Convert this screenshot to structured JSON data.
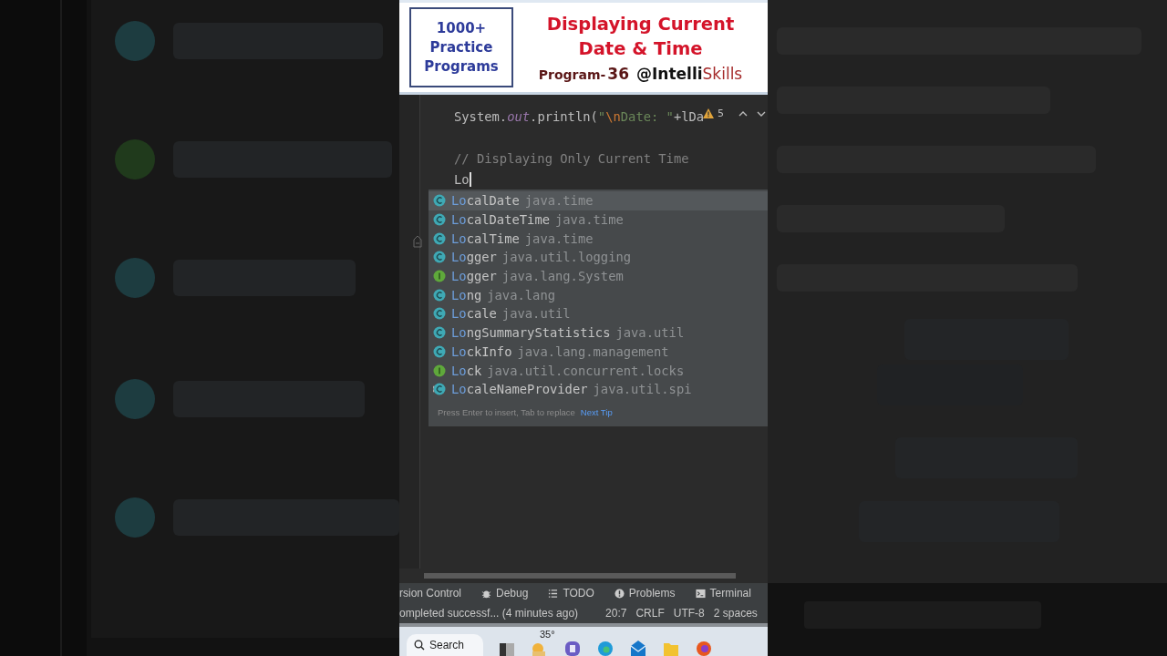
{
  "banner": {
    "badge_lines": [
      "1000+",
      "Practice",
      "Programs"
    ],
    "title_lines": [
      "Displaying Current",
      "Date & Time"
    ],
    "program_label": "Program-",
    "program_number": "36",
    "channel_main": "@Intelli",
    "channel_accent": "Skills"
  },
  "editor": {
    "code_line": [
      {
        "kind": "plain",
        "text": "System."
      },
      {
        "kind": "field",
        "text": "out"
      },
      {
        "kind": "plain",
        "text": ".println("
      },
      {
        "kind": "string",
        "text": "\""
      },
      {
        "kind": "escape",
        "text": "\\n"
      },
      {
        "kind": "string",
        "text": "Date: \""
      },
      {
        "kind": "plain",
        "text": "+lDa"
      }
    ],
    "inspection": {
      "count": "5"
    },
    "comment": "// Displaying Only Current Time",
    "typed": "Lo"
  },
  "completion": {
    "items": [
      {
        "match": "Lo",
        "rest": "calDate",
        "package": "java.time",
        "kind": "class",
        "selected": true
      },
      {
        "match": "Lo",
        "rest": "calDateTime",
        "package": "java.time",
        "kind": "class",
        "selected": false
      },
      {
        "match": "Lo",
        "rest": "calTime",
        "package": "java.time",
        "kind": "class",
        "selected": false
      },
      {
        "match": "Lo",
        "rest": "gger",
        "package": "java.util.logging",
        "kind": "class",
        "selected": false
      },
      {
        "match": "Lo",
        "rest": "gger",
        "package": "java.lang.System",
        "kind": "interface",
        "selected": false
      },
      {
        "match": "Lo",
        "rest": "ng",
        "package": "java.lang",
        "kind": "class",
        "selected": false
      },
      {
        "match": "Lo",
        "rest": "cale",
        "package": "java.util",
        "kind": "class",
        "selected": false
      },
      {
        "match": "Lo",
        "rest": "ngSummaryStatistics",
        "package": "java.util",
        "kind": "class",
        "selected": false
      },
      {
        "match": "Lo",
        "rest": "ckInfo",
        "package": "java.lang.management",
        "kind": "class",
        "selected": false
      },
      {
        "match": "Lo",
        "rest": "ck",
        "package": "java.util.concurrent.locks",
        "kind": "interface",
        "selected": false
      },
      {
        "match": "Lo",
        "rest": "caleNameProvider",
        "package": "java.util.spi",
        "kind": "abstract",
        "selected": false
      }
    ],
    "hint": "Press Enter to insert, Tab to replace",
    "tip_link": "Next Tip"
  },
  "tool_windows": [
    {
      "label": "rsion Control",
      "kind": "none"
    },
    {
      "label": "Debug",
      "kind": "bug"
    },
    {
      "label": "TODO",
      "kind": "list"
    },
    {
      "label": "Problems",
      "kind": "alert"
    },
    {
      "label": "Terminal",
      "kind": "terminal"
    }
  ],
  "status_bar": {
    "message": "ompleted successf... (4 minutes ago)",
    "items": [
      "20:7",
      "CRLF",
      "UTF-8",
      "2 spaces"
    ]
  },
  "taskbar": {
    "search": "Search",
    "weather": "35°"
  }
}
